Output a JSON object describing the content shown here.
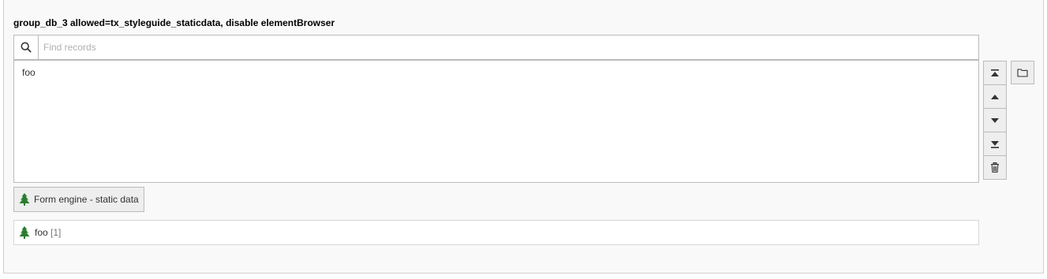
{
  "field": {
    "label": "group_db_3 allowed=tx_styleguide_staticdata, disable elementBrowser"
  },
  "search": {
    "placeholder": "Find records",
    "value": ""
  },
  "selected_items": [
    "foo"
  ],
  "controls": {
    "icons": [
      "move-top-icon",
      "move-up-icon",
      "move-down-icon",
      "move-bottom-icon",
      "trash-icon"
    ],
    "browse_icon": "folder-icon"
  },
  "table_button": {
    "label": "Form engine - static data",
    "icon": "tree-icon",
    "icon_color": "#2a7d2f"
  },
  "records": [
    {
      "title": "foo",
      "uid": "[1]"
    }
  ]
}
